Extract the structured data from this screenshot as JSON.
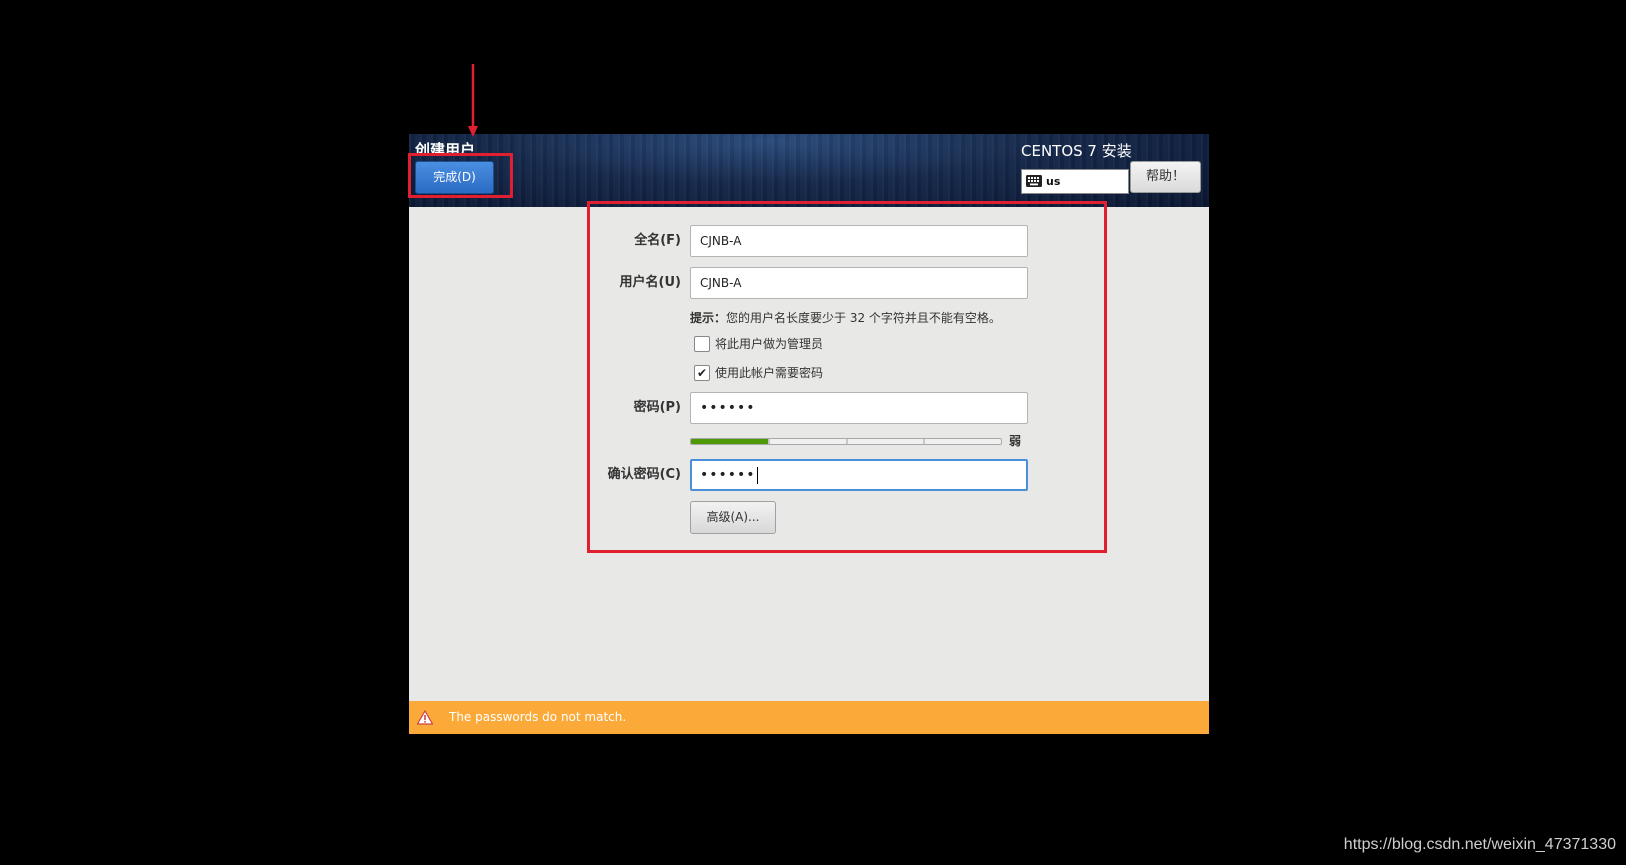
{
  "header": {
    "page_title": "创建用户",
    "done_button": "完成(D)",
    "install_title": "CENTOS 7 安装",
    "keyboard_layout": "us",
    "help_button": "帮助！"
  },
  "form": {
    "fullname_label": "全名(F)",
    "fullname_value": "CJNB-A",
    "username_label": "用户名(U)",
    "username_value": "CJNB-A",
    "hint_bold": "提示：",
    "hint_text": "您的用户名长度要少于 32 个字符并且不能有空格。",
    "admin_checkbox_label": "将此用户做为管理员",
    "admin_checked": false,
    "require_password_label": "使用此帐户需要密码",
    "require_password_checked": true,
    "password_label": "密码(P)",
    "password_value": "••••••",
    "strength_label": "弱",
    "strength_level": 0.25,
    "confirm_label": "确认密码(C)",
    "confirm_value": "••••••",
    "advanced_button": "高级(A)..."
  },
  "warning": {
    "message": "The passwords do not match."
  },
  "watermark": "https://blog.csdn.net/weixin_47371330",
  "colors": {
    "accent": "#2b6bc4",
    "warning": "#fbaa3a",
    "annotation": "#e02030",
    "strength": "#4e9a06"
  },
  "icons": {
    "keyboard": "keyboard-icon",
    "warning": "warning-icon",
    "check": "check-icon"
  }
}
